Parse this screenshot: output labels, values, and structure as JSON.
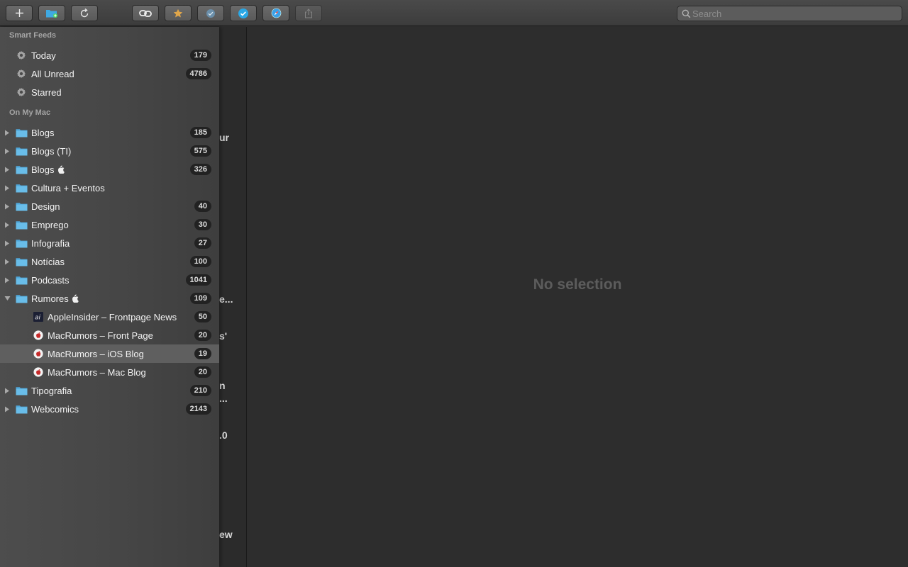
{
  "toolbar": {
    "buttons": [
      {
        "name": "add-button",
        "icon": "plus-icon"
      },
      {
        "name": "new-folder-button",
        "icon": "folder-add-icon"
      },
      {
        "name": "refresh-button",
        "icon": "refresh-icon"
      },
      {
        "name": "mark-all-read-button",
        "icon": "link-icon"
      },
      {
        "name": "star-button",
        "icon": "star-icon"
      },
      {
        "name": "mark-read-button",
        "icon": "check-circle-icon"
      },
      {
        "name": "next-unread-button",
        "icon": "check-badge-icon"
      },
      {
        "name": "open-in-browser-button",
        "icon": "safari-compass-icon"
      },
      {
        "name": "share-button",
        "icon": "share-icon"
      }
    ],
    "search_placeholder": "Search"
  },
  "sidebar": {
    "smart_feeds_header": "Smart Feeds",
    "smart_feeds": [
      {
        "label": "Today",
        "count": "179"
      },
      {
        "label": "All Unread",
        "count": "4786"
      },
      {
        "label": "Starred",
        "count": ""
      }
    ],
    "on_my_mac_header": "On My Mac",
    "folders": [
      {
        "label": "Blogs",
        "count": "185",
        "apple": false
      },
      {
        "label": "Blogs (TI)",
        "count": "575",
        "apple": false
      },
      {
        "label": "Blogs",
        "count": "326",
        "apple": true
      },
      {
        "label": "Cultura + Eventos",
        "count": "",
        "apple": false
      },
      {
        "label": "Design",
        "count": "40",
        "apple": false
      },
      {
        "label": "Emprego",
        "count": "30",
        "apple": false
      },
      {
        "label": "Infografia",
        "count": "27",
        "apple": false
      },
      {
        "label": "Notícias",
        "count": "100",
        "apple": false
      },
      {
        "label": "Podcasts",
        "count": "1041",
        "apple": false
      },
      {
        "label": "Rumores",
        "count": "109",
        "apple": true,
        "expanded": true
      }
    ],
    "feeds": [
      {
        "label": "AppleInsider – Frontpage News",
        "count": "50",
        "icon": "ai"
      },
      {
        "label": "MacRumors – Front Page",
        "count": "20",
        "icon": "macrumors"
      },
      {
        "label": "MacRumors – iOS Blog",
        "count": "19",
        "icon": "macrumors",
        "selected": true
      },
      {
        "label": "MacRumors – Mac Blog",
        "count": "20",
        "icon": "macrumors"
      }
    ],
    "folders_after": [
      {
        "label": "Tipografia",
        "count": "210"
      },
      {
        "label": "Webcomics",
        "count": "2143"
      }
    ]
  },
  "timeline_fragments": [
    "ur",
    "e...",
    "s'",
    "n",
    "...",
    ".0",
    "ew"
  ],
  "detail": {
    "empty_message": "No selection"
  },
  "colors": {
    "accent": "#2aa8e6",
    "folder": "#5ab0e0",
    "badge_bg": "#222222"
  }
}
